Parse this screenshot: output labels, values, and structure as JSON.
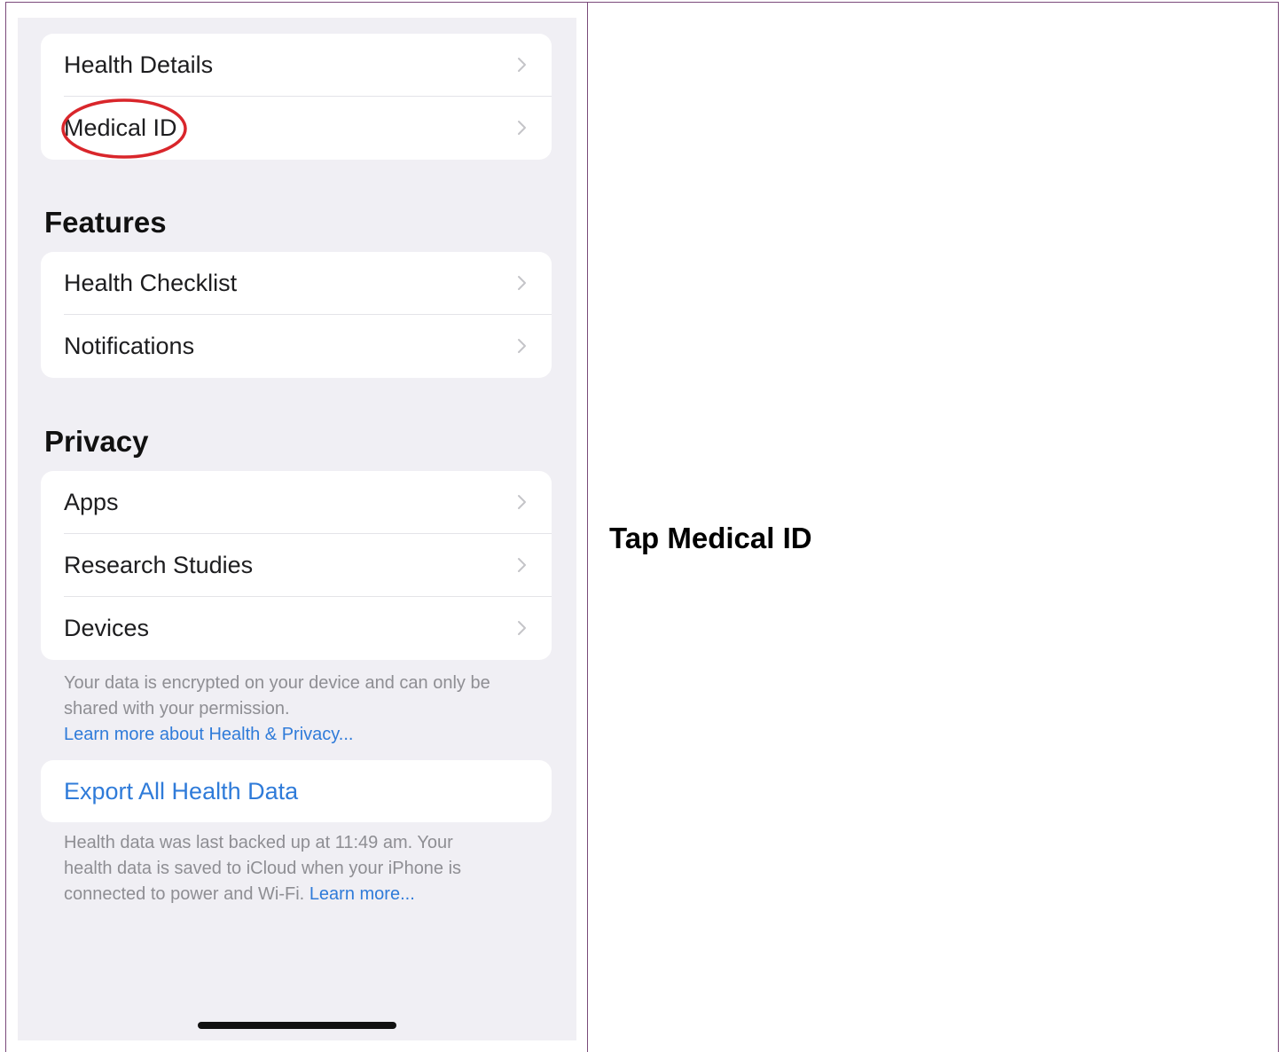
{
  "settings": {
    "top_group": [
      "Health Details",
      "Medical ID"
    ],
    "features": {
      "heading": "Features",
      "items": [
        "Health Checklist",
        "Notifications"
      ]
    },
    "privacy": {
      "heading": "Privacy",
      "items": [
        "Apps",
        "Research Studies",
        "Devices"
      ],
      "footer_text": "Your data is encrypted on your device and can only be shared with your permission.",
      "footer_link": "Learn more about Health & Privacy..."
    },
    "export": {
      "label": "Export All Health Data",
      "footer_text": "Health data was last backed up at 11:49 am. Your health data is saved to iCloud when your iPhone is connected to power and Wi-Fi.",
      "footer_link": "Learn more..."
    }
  },
  "highlight_color": "#d9262b",
  "instruction": "Tap Medical ID"
}
